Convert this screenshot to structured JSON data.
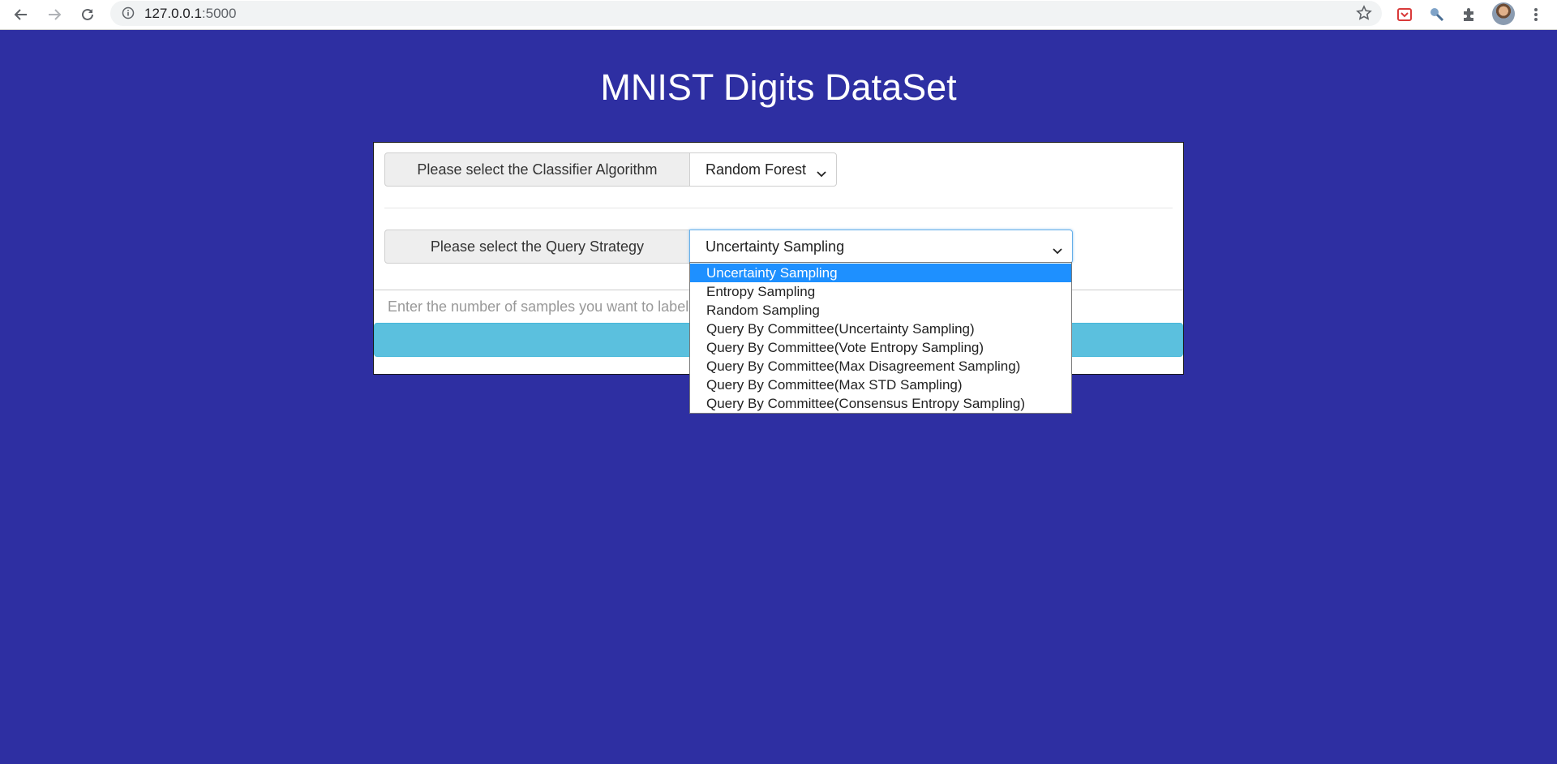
{
  "browser": {
    "url_host": "127.0.0.1",
    "url_port": ":5000",
    "icons": [
      "back-icon",
      "forward-icon",
      "reload-icon",
      "info-icon",
      "bookmark-star-icon",
      "pocket-extension-icon",
      "search-extension-icon",
      "extensions-puzzle-icon",
      "profile-avatar",
      "menu-kebab-icon"
    ]
  },
  "page": {
    "title": "MNIST Digits DataSet",
    "background_color": "#2e2fa2"
  },
  "form": {
    "classifier_label": "Please select the Classifier Algorithm",
    "classifier_value": "Random Forest",
    "strategy_label": "Please select the Query Strategy",
    "strategy_value": "Uncertainty Sampling",
    "samples_placeholder": "Enter the number of samples you want to label",
    "submit_color": "#5bc0de"
  },
  "strategy_options": [
    "Uncertainty Sampling",
    "Entropy Sampling",
    "Random Sampling",
    "Query By Committee(Uncertainty Sampling)",
    "Query By Committee(Vote Entropy Sampling)",
    "Query By Committee(Max Disagreement Sampling)",
    "Query By Committee(Max STD Sampling)",
    "Query By Committee(Consensus Entropy Sampling)"
  ]
}
